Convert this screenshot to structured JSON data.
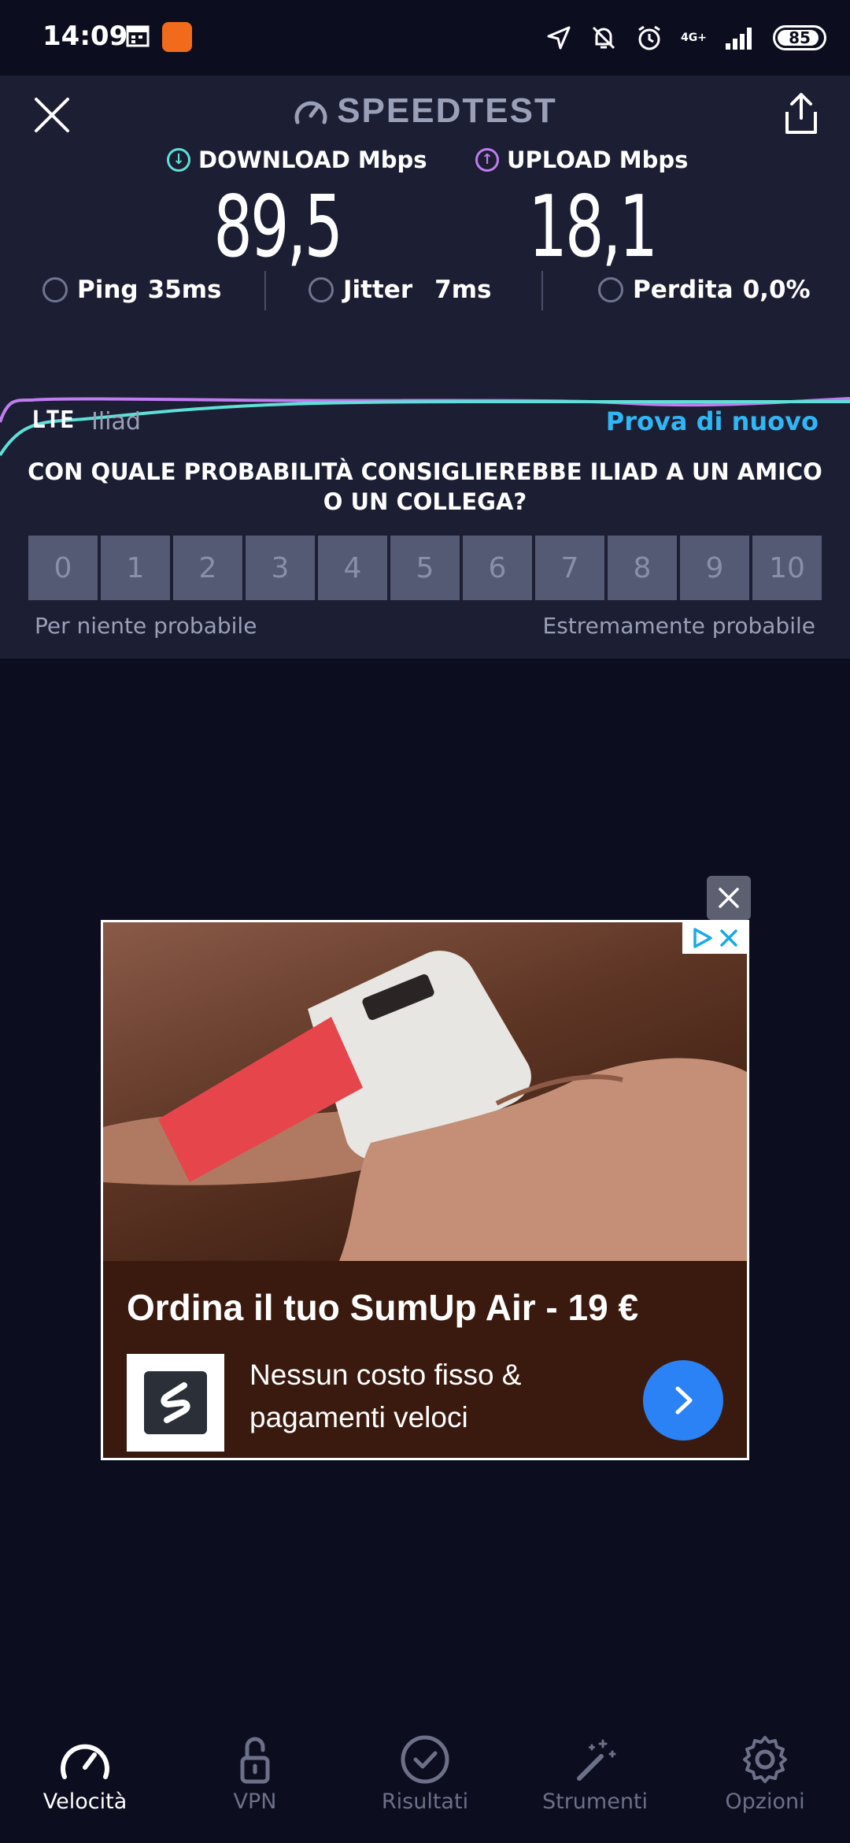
{
  "status_bar": {
    "time": "14:09",
    "network": "4G+",
    "battery": "85"
  },
  "header": {
    "title": "SPEEDTEST"
  },
  "results": {
    "download_label": "DOWNLOAD Mbps",
    "download_value": "89,5",
    "upload_label": "UPLOAD Mbps",
    "upload_value": "18,1",
    "ping_label": "Ping",
    "ping_value": "35ms",
    "jitter_label": "Jitter",
    "jitter_value": "7ms",
    "loss_label": "Perdita",
    "loss_value": "0,0%"
  },
  "connection": {
    "type": "LTE",
    "carrier": "Iliad",
    "retry": "Prova di nuovo"
  },
  "survey": {
    "question": "CON QUALE PROBABILITÀ CONSIGLIEREBBE ILIAD A UN AMICO O UN COLLEGA?",
    "scale": [
      "0",
      "1",
      "2",
      "3",
      "4",
      "5",
      "6",
      "7",
      "8",
      "9",
      "10"
    ],
    "low_label": "Per niente probabile",
    "high_label": "Estremamente probabile"
  },
  "ad": {
    "title": "Ordina il tuo SumUp Air - 19 €",
    "description": "Nessun costo fisso & pagamenti veloci"
  },
  "nav": {
    "items": [
      {
        "label": "Velocità",
        "icon": "speedometer-icon",
        "active": true
      },
      {
        "label": "VPN",
        "icon": "lock-open-icon",
        "active": false
      },
      {
        "label": "Risultati",
        "icon": "check-circle-icon",
        "active": false
      },
      {
        "label": "Strumenti",
        "icon": "magic-wand-icon",
        "active": false
      },
      {
        "label": "Opzioni",
        "icon": "gear-icon",
        "active": false
      }
    ]
  },
  "colors": {
    "download": "#5ee0d8",
    "upload": "#c07cf0",
    "accent": "#2fb6f5",
    "panel": "#1c1e33",
    "background": "#0c0e1f"
  }
}
